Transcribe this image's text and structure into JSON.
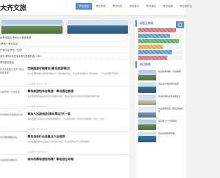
{
  "site": {
    "logo_text": "大齐文旅"
  },
  "nav": {
    "items": [
      "青岛旅游",
      "青岛导游",
      "青岛包车",
      "青岛景点",
      "青岛酒店",
      "青岛线路",
      "青岛旅行社"
    ],
    "active_index": 0
  },
  "featured": [
    {
      "title": "青岛自由行下青岛四日自由行攻略"
    },
    {
      "title": "青岛自由行下青岛四日自由行攻略"
    }
  ],
  "quick_list": [
    "的青岛旅游·青岛七人美食推荐",
    "(青岛)+青岛导游",
    "户旅行社·青岛一日游",
    "游去(青岛)私导当地青岛旅游的游(小码)",
    "青岛旅游电话"
  ],
  "articles": [
    {
      "category": "历青岛旅游青岛热门景点线路推荐",
      "title": "定制旅游攻略青岛(青岛旅游预訂)",
      "excerpt": "本文主要整理青岛旅游攻略景点介绍的相关信息，青岛旅游攻略及行程问答等——青岛旅游风景很多……",
      "meta": "青岛旅游  2020-01-01"
    },
    {
      "category": "当地导游 · 青岛旅游",
      "title": "青岛旅游包车自驾游：青岛周边旅游",
      "excerpt": "本文主要整理青岛旅游包车的相关信息，青岛旅游包车及青岛旅游路线推荐问答……",
      "meta": "青岛旅游  2020-01-01"
    },
    {
      "category": "青岛旅游(青岛周边1日)",
      "title": "青岛大巡游旅游(青岛周边)天一游",
      "excerpt": "本文主要介绍青岛大巡游旅游的信息，以及青岛周边一日游大巡游路线、费用、景点……",
      "meta": "青岛旅游  2020-01-01"
    },
    {
      "category": "青岛旅游路线景点",
      "title": "青岛自由行必游景点大全推荐",
      "excerpt": "本文主要整理青岛自由行必游景点信息，青岛各区热门景点游玩推荐……",
      "meta": "青岛旅游  2020-01-01"
    },
    {
      "category": "青岛旅游攻略景点",
      "title": "贵州的青岛旅游攻略？青岛游全攻略",
      "excerpt": "",
      "meta": ""
    }
  ],
  "sidebar": {
    "tags_title": "标签云推荐",
    "tag_bars": [
      {
        "level": 0.85,
        "color": "r"
      },
      {
        "level": 0.7,
        "color": "b"
      },
      {
        "level": 0.9,
        "color": "g"
      },
      {
        "level": 0.55,
        "color": "o"
      },
      {
        "level": 0.75,
        "color": "b"
      },
      {
        "level": 0.65,
        "color": "r"
      }
    ],
    "recommend_title": "热门推荐",
    "recommend": [
      {
        "text": "青岛旅游攻略一日游推荐"
      },
      {
        "text": "青岛海水浴场游玩指南"
      },
      {
        "text": "青岛旅游青岛周边游大全"
      },
      {
        "text": "青岛旅游景区门票及开放时间"
      },
      {
        "text": "青岛崂山一日游路线"
      },
      {
        "text": "青岛栈桥旅游攻略"
      }
    ]
  },
  "colors": {
    "accent": "#5a8dd6"
  }
}
